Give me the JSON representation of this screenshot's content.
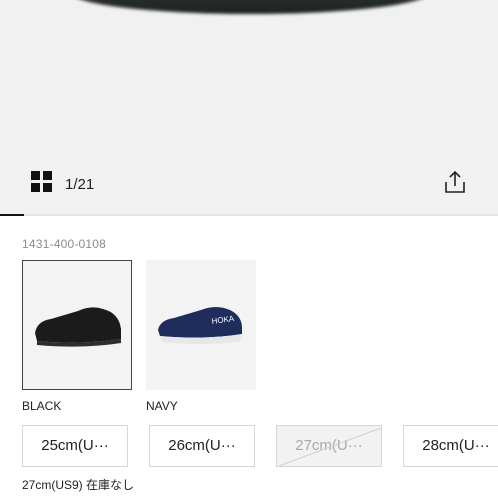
{
  "gallery": {
    "counter": "1/21",
    "current_image": 1,
    "total_images": 21,
    "grid_icon": "grid-icon",
    "share_icon": "share-icon"
  },
  "product": {
    "sku": "1431-400-0108"
  },
  "colors": [
    {
      "label": "BLACK",
      "selected": true
    },
    {
      "label": "NAVY",
      "selected": false
    }
  ],
  "sizes": [
    {
      "label": "25cm(U···",
      "available": true
    },
    {
      "label": "26cm(U···",
      "available": true
    },
    {
      "label": "27cm(U···",
      "available": false
    },
    {
      "label": "28cm(U···",
      "available": true
    }
  ],
  "stock_note": "27cm(US9) 在庫なし",
  "theme": {
    "accent": "#111111",
    "border": "#d6d6d6",
    "muted_text": "#8d8d8d"
  }
}
